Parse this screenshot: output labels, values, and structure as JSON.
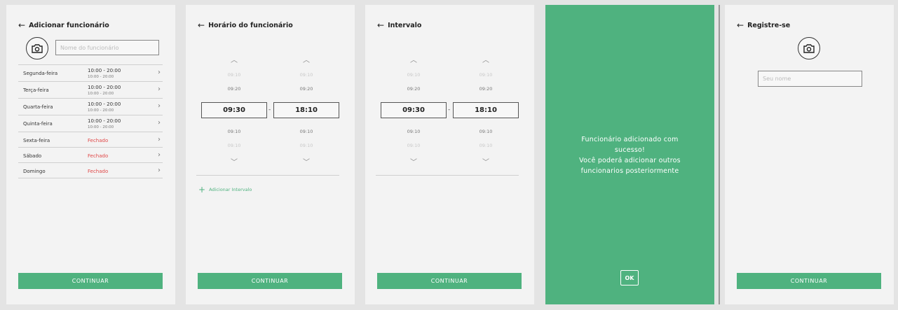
{
  "screen1": {
    "title": "Adicionar funcionário",
    "name_placeholder": "Nome do funcionário",
    "days": [
      {
        "name": "Segunda-feira",
        "time": "10:00 - 20:00",
        "sub": "10:00 - 20:00",
        "closed": false
      },
      {
        "name": "Terça-feira",
        "time": "10:00 - 20:00",
        "sub": "10:00 - 20:00",
        "closed": false
      },
      {
        "name": "Quarta-feira",
        "time": "10:00 - 20:00",
        "sub": "10:00 - 20:00",
        "closed": false
      },
      {
        "name": "Quinta-feira",
        "time": "10:00 - 20:00",
        "sub": "10:00 - 20:00",
        "closed": false
      },
      {
        "name": "Sexta-feira",
        "time": "Fechado",
        "closed": true
      },
      {
        "name": "Sábado",
        "time": "Fechado",
        "closed": true
      },
      {
        "name": "Domingo",
        "time": "Fechado",
        "closed": true
      }
    ],
    "button": "CONTINUAR"
  },
  "screen2": {
    "title": "Horário do funcionário",
    "start": {
      "above2": "09:10",
      "above1": "09:20",
      "selected": "09:30",
      "below1": "09:10",
      "below2": "09:10"
    },
    "end": {
      "above2": "09:10",
      "above1": "09:20",
      "selected": "18:10",
      "below1": "09:10",
      "below2": "09:10"
    },
    "separator": "-",
    "add_interval": "Adicionar Intervalo",
    "button": "CONTINUAR"
  },
  "screen3": {
    "title": "Intervalo",
    "start": {
      "above2": "09:10",
      "above1": "09:20",
      "selected": "09:30",
      "below1": "09:10",
      "below2": "09:10"
    },
    "end": {
      "above2": "09:10",
      "above1": "09:20",
      "selected": "18:10",
      "below1": "09:10",
      "below2": "09:10"
    },
    "separator": "-",
    "button": "CONTINUAR"
  },
  "screen4": {
    "line1": "Funcionário adicionado com",
    "line2": "sucesso!",
    "line3": "Você poderá adicionar outros",
    "line4": "funcionarios posteriormente",
    "ok": "OK"
  },
  "screen5": {
    "title": "Registre-se",
    "name_placeholder": "Seu nome",
    "button": "CONTINUAR"
  },
  "colors": {
    "accent": "#4fb27f",
    "closed": "#e04848",
    "background": "#e4e4e4",
    "screen": "#f3f3f3"
  },
  "icons": {
    "back": "arrow-left-icon",
    "camera": "camera-icon",
    "chevron_right": "chevron-right-icon",
    "chevron_up": "chevron-up-icon",
    "chevron_down": "chevron-down-icon",
    "plus": "plus-icon"
  }
}
